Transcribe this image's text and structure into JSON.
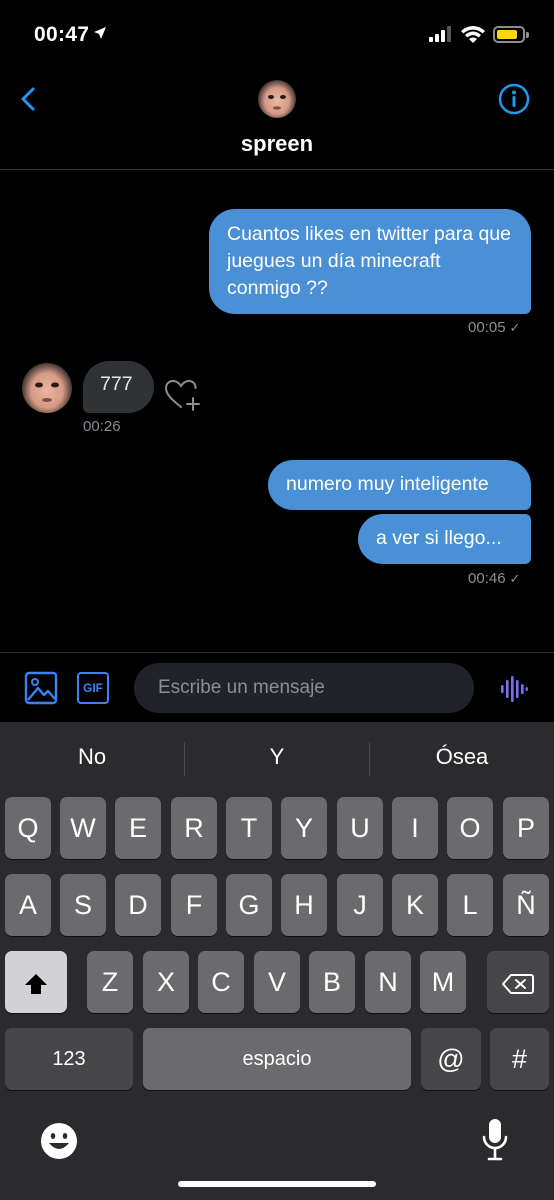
{
  "status": {
    "time": "00:47"
  },
  "header": {
    "name": "spreen"
  },
  "messages": [
    {
      "text": "Cuantos likes en twitter para que juegues un día minecraft conmigo ??",
      "time": "00:05"
    },
    {
      "text": "777",
      "time": "00:26"
    },
    {
      "text": "numero muy inteligente"
    },
    {
      "text": "a ver si llego...",
      "time": "00:46"
    }
  ],
  "composer": {
    "gif_label": "GIF",
    "placeholder": "Escribe un mensaje"
  },
  "keyboard": {
    "suggestions": [
      "No",
      "Y",
      "Ósea"
    ],
    "row1": [
      "Q",
      "W",
      "E",
      "R",
      "T",
      "Y",
      "U",
      "I",
      "O",
      "P"
    ],
    "row2": [
      "A",
      "S",
      "D",
      "F",
      "G",
      "H",
      "J",
      "K",
      "L",
      "Ñ"
    ],
    "row3": [
      "Z",
      "X",
      "C",
      "V",
      "B",
      "N",
      "M"
    ],
    "numbers_label": "123",
    "space_label": "espacio",
    "at_label": "@",
    "hash_label": "#"
  },
  "colors": {
    "accent": "#1d9bf0",
    "outgoing_bubble": "#4a90d6",
    "incoming_bubble": "#2f3336",
    "background": "#000000"
  }
}
